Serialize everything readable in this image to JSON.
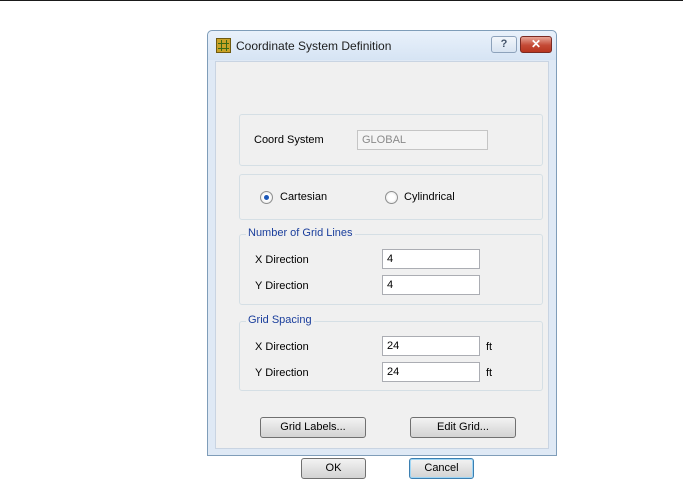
{
  "dialog": {
    "title": "Coordinate System Definition",
    "help_glyph": "?",
    "close_glyph": "✕"
  },
  "coord_system": {
    "label": "Coord System",
    "value": "GLOBAL"
  },
  "system_type": {
    "options": [
      {
        "label": "Cartesian",
        "selected": true
      },
      {
        "label": "Cylindrical",
        "selected": false
      }
    ]
  },
  "grid_lines": {
    "legend": "Number of Grid Lines",
    "x_label": "X Direction",
    "x_value": "4",
    "y_label": "Y Direction",
    "y_value": "4"
  },
  "grid_spacing": {
    "legend": "Grid Spacing",
    "x_label": "X Direction",
    "x_value": "24",
    "x_unit": "ft",
    "y_label": "Y Direction",
    "y_value": "24",
    "y_unit": "ft"
  },
  "buttons": {
    "grid_labels": "Grid Labels...",
    "edit_grid": "Edit Grid...",
    "ok": "OK",
    "cancel": "Cancel"
  }
}
